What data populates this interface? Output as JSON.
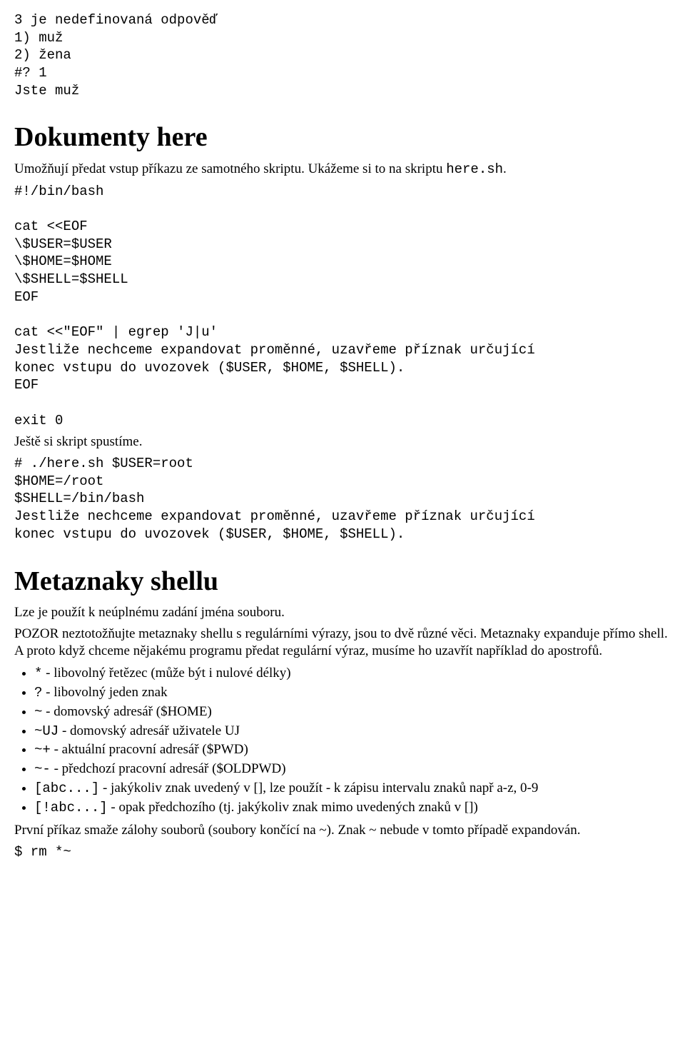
{
  "pre_top": "3 je nedefinovaná odpověď\n1) muž\n2) žena\n#? 1\nJste muž",
  "h1_here": "Dokumenty here",
  "intro_here_1": "Umožňují předat vstup příkazu ze samotného skriptu. Ukážeme si to na skriptu ",
  "intro_here_code": "here.sh",
  "intro_here_2": ".",
  "pre_here_script": "#!/bin/bash\n\ncat <<EOF\n\\$USER=$USER\n\\$HOME=$HOME\n\\$SHELL=$SHELL\nEOF\n\ncat <<\"EOF\" | egrep 'J|u'\nJestliže nechceme expandovat proměnné, uzavřeme příznak určující\nkonec vstupu do uvozovek ($USER, $HOME, $SHELL).\nEOF\n\nexit 0",
  "still_run": "Ještě si skript spustíme.",
  "pre_here_run": "# ./here.sh $USER=root\n$HOME=/root\n$SHELL=/bin/bash\nJestliže nechceme expandovat proměnné, uzavřeme příznak určující\nkonec vstupu do uvozovek ($USER, $HOME, $SHELL).",
  "h1_meta": "Metaznaky shellu",
  "meta_p1": "Lze je použít k neúplnému zadání jména souboru.",
  "meta_p2": "POZOR neztotožňujte metaznaky shellu s regulárními výrazy, jsou to dvě různé věci. Metaznaky expanduje přímo shell. A proto když chceme nějakému programu předat regulární výraz, musíme ho uzavřít například do apostrofů.",
  "items": [
    {
      "code": "*",
      "text": " - libovolný řetězec (může být i nulové délky)"
    },
    {
      "code": "?",
      "text": " - libovolný jeden znak"
    },
    {
      "code": "~",
      "text": " - domovský adresář ($HOME)"
    },
    {
      "code": "~UJ",
      "text": " - domovský adresář uživatele UJ"
    },
    {
      "code": "~+",
      "text": " - aktuální pracovní adresář ($PWD)"
    },
    {
      "code": "~-",
      "text": " - předchozí pracovní adresář ($OLDPWD)"
    },
    {
      "code": "[abc...]",
      "text": " - jakýkoliv znak uvedený v [], lze použít - k zápisu intervalu znaků např a-z, 0-9"
    },
    {
      "code": "[!abc...]",
      "text": " - opak předchozího (tj. jakýkoliv znak mimo uvedených znaků v [])"
    }
  ],
  "last_p1": "První příkaz smaže zálohy souborů (soubory končící na ~). Znak ~ nebude v tomto případě expandován.",
  "cmd_rm": "$ rm *~"
}
